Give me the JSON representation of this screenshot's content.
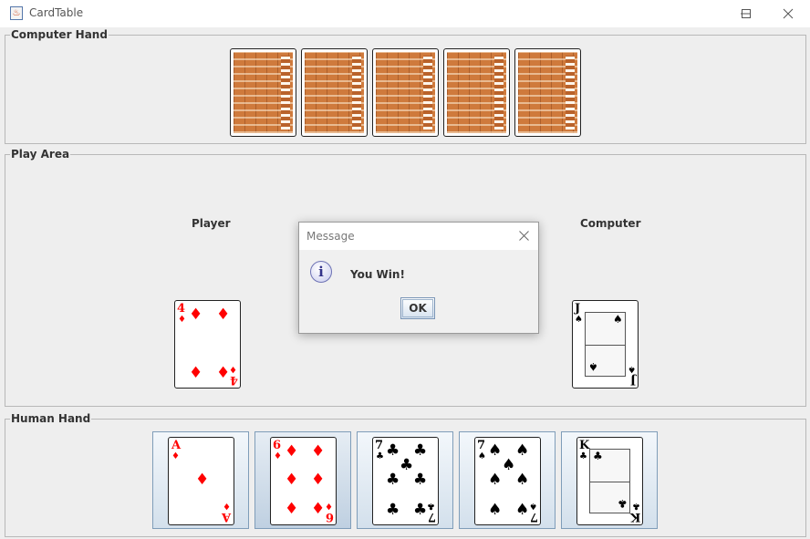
{
  "window": {
    "title": "CardTable",
    "app_icon": "java-cup-icon"
  },
  "colors": {
    "red_suit": "#ff0000",
    "black_suit": "#000000",
    "card_back": "#cf7a3c"
  },
  "computer_hand": {
    "label": "Computer Hand",
    "card_count": 5,
    "face_down": true
  },
  "play_area": {
    "label": "Play Area",
    "player_label": "Player",
    "computer_label": "Computer",
    "player_card": {
      "rank": "4",
      "suit": "♦"
    },
    "computer_card": {
      "rank": "J",
      "suit": "♠"
    }
  },
  "human_hand": {
    "label": "Human Hand",
    "selected_index": 1,
    "cards": [
      {
        "rank": "A",
        "suit": "♦"
      },
      {
        "rank": "6",
        "suit": "♦"
      },
      {
        "rank": "7",
        "suit": "♣"
      },
      {
        "rank": "7",
        "suit": "♠"
      },
      {
        "rank": "K",
        "suit": "♣"
      }
    ]
  },
  "dialog": {
    "title": "Message",
    "message": "You Win!",
    "ok_label": "OK",
    "icon": "info-icon"
  }
}
